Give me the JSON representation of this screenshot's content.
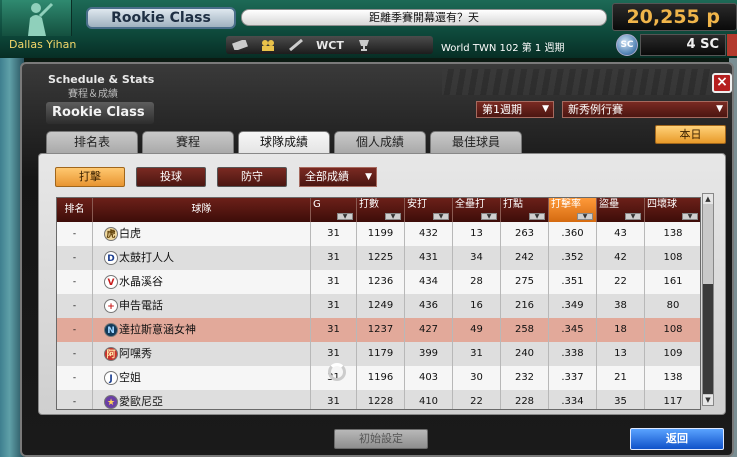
{
  "header": {
    "class_badge": "Rookie Class",
    "season_message": "距離季賽開幕還有？天",
    "money": "20,255 p",
    "username": "Dallas Yihan",
    "iconbar": {
      "wct_label": "WCT"
    },
    "week_text": "World TWN 102 第 1 週期",
    "sc_label": "SC",
    "sc_amount": "4 SC"
  },
  "dialog": {
    "title_en": "Schedule & Stats",
    "title_zh": "賽程＆成績",
    "class_label": "Rookie Class",
    "week_select": "第1週期",
    "league_select": "新秀例行賽",
    "today_button": "本日",
    "tabs": [
      {
        "label": "排名表"
      },
      {
        "label": "賽程"
      },
      {
        "label": "球隊成績",
        "active": true
      },
      {
        "label": "個人成績"
      },
      {
        "label": "最佳球員"
      }
    ],
    "categories": [
      {
        "label": "打擊",
        "active": true
      },
      {
        "label": "投球"
      },
      {
        "label": "防守"
      }
    ],
    "filter_select": "全部成績",
    "columns": [
      "排名",
      "球隊",
      "G",
      "打數",
      "安打",
      "全壘打",
      "打點",
      "打擊率",
      "盜壘",
      "四壞球"
    ],
    "rows": [
      {
        "rank": "-",
        "logo": "tiger",
        "team": "白虎",
        "g": "31",
        "ab": "1199",
        "h": "432",
        "hr": "13",
        "rbi": "263",
        "avg": ".360",
        "sb": "43",
        "bb": "138"
      },
      {
        "rank": "-",
        "logo": "drum",
        "team": "太鼓打人人",
        "g": "31",
        "ab": "1225",
        "h": "431",
        "hr": "34",
        "rbi": "242",
        "avg": ".352",
        "sb": "42",
        "bb": "108"
      },
      {
        "rank": "-",
        "logo": "crystal",
        "team": "水晶溪谷",
        "g": "31",
        "ab": "1236",
        "h": "434",
        "hr": "28",
        "rbi": "275",
        "avg": ".351",
        "sb": "22",
        "bb": "161"
      },
      {
        "rank": "-",
        "logo": "phone",
        "team": "申告電話",
        "g": "31",
        "ab": "1249",
        "h": "436",
        "hr": "16",
        "rbi": "216",
        "avg": ".349",
        "sb": "38",
        "bb": "80"
      },
      {
        "rank": "-",
        "logo": "goddess",
        "team": "達拉斯意涵女神",
        "g": "31",
        "ab": "1237",
        "h": "427",
        "hr": "49",
        "rbi": "258",
        "avg": ".345",
        "sb": "18",
        "bb": "108",
        "selected": true
      },
      {
        "rank": "-",
        "logo": "ahfu",
        "team": "阿嘿秀",
        "g": "31",
        "ab": "1179",
        "h": "399",
        "hr": "31",
        "rbi": "240",
        "avg": ".338",
        "sb": "13",
        "bb": "109"
      },
      {
        "rank": "-",
        "logo": "j",
        "team": "空姐",
        "g": "31",
        "ab": "1196",
        "h": "403",
        "hr": "30",
        "rbi": "232",
        "avg": ".337",
        "sb": "21",
        "bb": "138"
      },
      {
        "rank": "-",
        "logo": "star",
        "team": "愛歐尼亞",
        "g": "31",
        "ab": "1228",
        "h": "410",
        "hr": "22",
        "rbi": "228",
        "avg": ".334",
        "sb": "35",
        "bb": "117"
      }
    ],
    "init_button": "初始設定",
    "back_button": "返回"
  }
}
